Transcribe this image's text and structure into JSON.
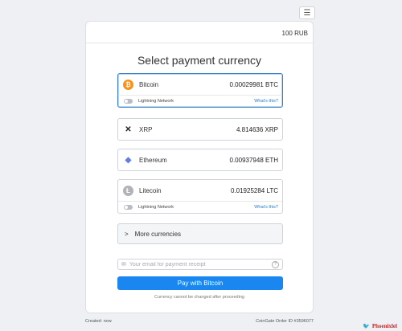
{
  "header": {
    "menu_icon": "list-icon",
    "amount": "100 RUB"
  },
  "title": "Select payment currency",
  "currencies": [
    {
      "name": "Bitcoin",
      "amount": "0.00029981 BTC",
      "icon": "bitcoin-icon",
      "icon_symbol": "₿",
      "color": "#f7931a",
      "lightning": true,
      "selected": true
    },
    {
      "name": "XRP",
      "amount": "4.814636 XRP",
      "icon": "xrp-icon",
      "icon_symbol": "✕",
      "color": "#222222",
      "lightning": false
    },
    {
      "name": "Ethereum",
      "amount": "0.00937948 ETH",
      "icon": "ethereum-icon",
      "icon_symbol": "◆",
      "color": "#627eea",
      "lightning": false
    },
    {
      "name": "Litecoin",
      "amount": "0.01925284 LTC",
      "icon": "litecoin-icon",
      "icon_symbol": "Ł",
      "color": "#b0b3b8",
      "lightning": true
    }
  ],
  "lightning": {
    "label": "Lightning Network",
    "help_link": "What's this?"
  },
  "more_currencies": {
    "label": "More currencies",
    "icon": "chevron-right-icon"
  },
  "email": {
    "placeholder": "Your email for payment receipt",
    "icon": "envelope-icon",
    "help_icon": "question-icon"
  },
  "pay_button": "Pay with Bitcoin",
  "note": "Currency cannot be changed after proceeding",
  "footer": {
    "created": "Created: now",
    "order": "CoinGate Order ID #3596077"
  },
  "watermark": "Phoenixlel",
  "colors": {
    "accent": "#1a86f0",
    "selected_border": "#3b82c4",
    "link": "#2a7cc4"
  }
}
